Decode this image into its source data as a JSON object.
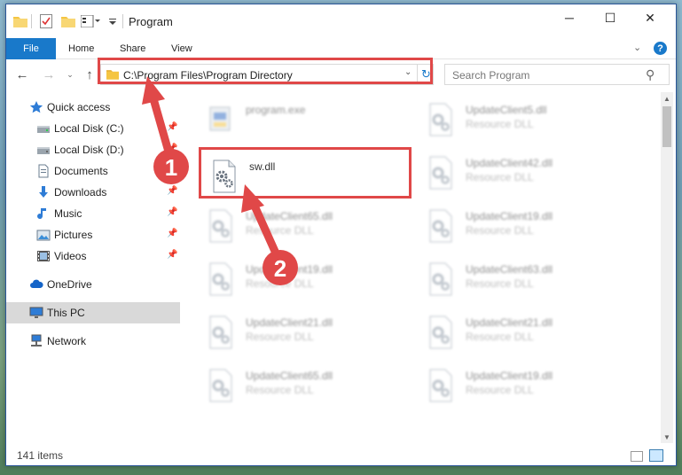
{
  "window": {
    "title": "Program",
    "controls": {
      "minimize": "─",
      "maximize": "☐",
      "close": "✕"
    }
  },
  "ribbon": {
    "tabs": [
      {
        "label": "File",
        "active": true
      },
      {
        "label": "Home"
      },
      {
        "label": "Share"
      },
      {
        "label": "View"
      }
    ],
    "expand_glyph": "⌄",
    "help_glyph": "?"
  },
  "nav": {
    "back_glyph": "←",
    "forward_glyph": "→",
    "recent_glyph": "⌄",
    "up_glyph": "↑",
    "address": "C:\\Program Files\\Program Directory",
    "address_drop_glyph": "⌄",
    "refresh_glyph": "↻",
    "search_placeholder": "Search Program",
    "search_glyph": "⚲"
  },
  "sidebar": {
    "items": [
      {
        "label": "Quick access",
        "icon": "star-icon",
        "pinned": false
      },
      {
        "label": "Local Disk (C:)",
        "icon": "drive-icon",
        "pinned": true
      },
      {
        "label": "Local Disk (D:)",
        "icon": "drive-icon",
        "pinned": true
      },
      {
        "label": "Documents",
        "icon": "document-icon",
        "pinned": true
      },
      {
        "label": "Downloads",
        "icon": "download-icon",
        "pinned": true
      },
      {
        "label": "Music",
        "icon": "music-icon",
        "pinned": true
      },
      {
        "label": "Pictures",
        "icon": "pictures-icon",
        "pinned": true
      },
      {
        "label": "Videos",
        "icon": "video-icon",
        "pinned": true
      },
      {
        "label": "OneDrive",
        "icon": "cloud-icon",
        "pinned": false
      },
      {
        "label": "This PC",
        "icon": "monitor-icon",
        "pinned": false,
        "selected": true
      },
      {
        "label": "Network",
        "icon": "network-icon",
        "pinned": false
      }
    ],
    "pin_glyph": "📌"
  },
  "files": [
    {
      "name": "program.exe",
      "type": "",
      "icon": "exe-icon",
      "blurred": true
    },
    {
      "name": "UpdateClient5.dll",
      "type": "Resource DLL",
      "icon": "dll-icon",
      "blurred": true
    },
    {
      "name": "sw.dll",
      "type": "",
      "icon": "dll-icon",
      "blurred": false
    },
    {
      "name": "UpdateClient42.dll",
      "type": "Resource DLL",
      "icon": "dll-icon",
      "blurred": true
    },
    {
      "name": "UpdateClient65.dll",
      "type": "Resource DLL",
      "icon": "dll-icon",
      "blurred": true
    },
    {
      "name": "UpdateClient19.dll",
      "type": "Resource DLL",
      "icon": "dll-icon",
      "blurred": true
    },
    {
      "name": "UpdateClient19.dll",
      "type": "Resource DLL",
      "icon": "dll-icon",
      "blurred": true
    },
    {
      "name": "UpdateClient63.dll",
      "type": "Resource DLL",
      "icon": "dll-icon",
      "blurred": true
    },
    {
      "name": "UpdateClient21.dll",
      "type": "Resource DLL",
      "icon": "dll-icon",
      "blurred": true
    },
    {
      "name": "UpdateClient21.dll",
      "type": "Resource DLL",
      "icon": "dll-icon",
      "blurred": true
    },
    {
      "name": "UpdateClient65.dll",
      "type": "Resource DLL",
      "icon": "dll-icon",
      "blurred": true
    },
    {
      "name": "UpdateClient19.dll",
      "type": "Resource DLL",
      "icon": "dll-icon",
      "blurred": true
    }
  ],
  "status": {
    "item_count": "141 items"
  },
  "annotations": {
    "step1": "1",
    "step2": "2",
    "color": "#e04848"
  },
  "colors": {
    "accent": "#1979ca",
    "selected": "#cce8ff"
  }
}
